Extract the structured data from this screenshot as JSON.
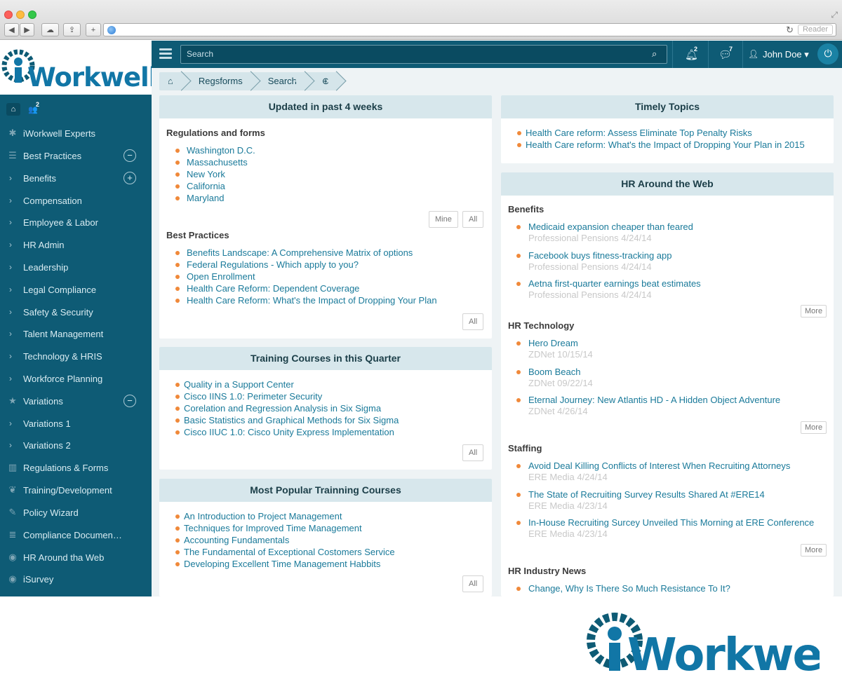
{
  "browser": {
    "reader_label": "Reader"
  },
  "brand": {
    "name_i": "i",
    "name_rest": "Workwell"
  },
  "sidebar": {
    "quick_badge": "2",
    "items": [
      {
        "label": "iWorkwell Experts",
        "icon": "asterisk-icon"
      },
      {
        "label": "Best Practices",
        "icon": "list-icon",
        "toggle": "−"
      },
      {
        "label": "Benefits",
        "chevron": "›",
        "toggle": "+"
      },
      {
        "label": "Compensation",
        "chevron": "›"
      },
      {
        "label": "Employee & Labor",
        "chevron": "›"
      },
      {
        "label": "HR Admin",
        "chevron": "›"
      },
      {
        "label": "Leadership",
        "chevron": "›"
      },
      {
        "label": "Legal Compliance",
        "chevron": "›"
      },
      {
        "label": "Safety & Security",
        "chevron": "›"
      },
      {
        "label": "Talent Management",
        "chevron": "›"
      },
      {
        "label": "Technology & HRIS",
        "chevron": "›"
      },
      {
        "label": "Workforce Planning",
        "chevron": "›"
      },
      {
        "label": "Variations",
        "icon": "star-icon",
        "toggle": "−"
      },
      {
        "label": "Variations 1",
        "chevron": "›"
      },
      {
        "label": "Variations 2",
        "chevron": "›"
      },
      {
        "label": "Regulations & Forms",
        "icon": "bar-chart-icon"
      },
      {
        "label": "Training/Development",
        "icon": "leaf-icon"
      },
      {
        "label": "Policy Wizard",
        "icon": "edit-icon"
      },
      {
        "label": "Compliance Documen…",
        "icon": "server-icon"
      },
      {
        "label": "HR Around tha Web",
        "icon": "rss-icon"
      },
      {
        "label": "iSurvey",
        "icon": "eye-icon"
      }
    ]
  },
  "topbar": {
    "search_placeholder": "Search",
    "notifications_count": "2",
    "messages_count": "7",
    "user_name": "John Doe"
  },
  "breadcrumb": {
    "items": [
      "Regsforms",
      "Search"
    ]
  },
  "panels": {
    "updated": {
      "title": "Updated in past 4 weeks",
      "regs_title": "Regulations and forms",
      "regs": [
        "Washington D.C.",
        "Massachusetts",
        "New York",
        "California",
        "Maryland"
      ],
      "mine_label": "Mine",
      "all_label": "All",
      "bp_title": "Best Practices",
      "bp": [
        "Benefits Landscape: A Comprehensive Matrix of options",
        "Federal Regulations - Which apply to you?",
        "Open Enrollment",
        "Health Care Reform: Dependent Coverage",
        "Health Care Reform: What's the Impact of Dropping Your Plan"
      ],
      "all_label_2": "All"
    },
    "training": {
      "title": "Training Courses in this Quarter",
      "items": [
        "Quality in a Support Center",
        "Cisco IINS 1.0: Perimeter Security",
        "Corelation and Regression Analysis in Six Sigma",
        "Basic Statistics and Graphical Methods for Six Sigma",
        "Cisco IIUC 1.0: Cisco Unity Express Implementation"
      ],
      "all_label": "All"
    },
    "popular": {
      "title": "Most Popular Trainning Courses",
      "items": [
        "An Introduction to Project Management",
        "Techniques for Improved Time Management",
        "Accounting Fundamentals",
        "The Fundamental of Exceptional Costomers Service",
        "Developing Excellent Time Management Habbits"
      ],
      "all_label": "All"
    },
    "timely": {
      "title": "Timely Topics",
      "items": [
        "Health Care reform: Assess   Eliminate Top Penalty Risks",
        "Health Care reform: What's the Impact of Dropping Your Plan in 2015"
      ]
    },
    "web": {
      "title": "HR Around the Web",
      "more_label": "More",
      "sections": [
        {
          "title": "Benefits",
          "items": [
            {
              "title": "Medicaid expansion cheaper than feared",
              "meta": "Professional Pensions 4/24/14"
            },
            {
              "title": "Facebook buys fitness-tracking app",
              "meta": "Professional Pensions 4/24/14"
            },
            {
              "title": "Aetna first-quarter earnings beat estimates",
              "meta": "Professional Pensions 4/24/14"
            }
          ]
        },
        {
          "title": "HR Technology",
          "items": [
            {
              "title": "Hero Dream",
              "meta": "ZDNet 10/15/14"
            },
            {
              "title": "Boom Beach",
              "meta": "ZDNet 09/22/14"
            },
            {
              "title": "Eternal Journey: New Atlantis HD - A Hidden Object Adventure",
              "meta": "ZDNet 4/26/14"
            }
          ]
        },
        {
          "title": "Staffing",
          "items": [
            {
              "title": "Avoid Deal Killing Conflicts of Interest When Recruiting Attorneys",
              "meta": "ERE Media 4/24/14"
            },
            {
              "title": "The State of Recruiting Survey Results Shared At #ERE14",
              "meta": "ERE Media 4/23/14"
            },
            {
              "title": "In-House Recruiting Surcey Unveiled This Morning at ERE Conference",
              "meta": "ERE Media 4/23/14"
            }
          ]
        },
        {
          "title": "HR Industry News",
          "items": [
            {
              "title": "Change, Why Is There So Much Resistance To It?",
              "meta": ""
            }
          ]
        }
      ]
    }
  }
}
